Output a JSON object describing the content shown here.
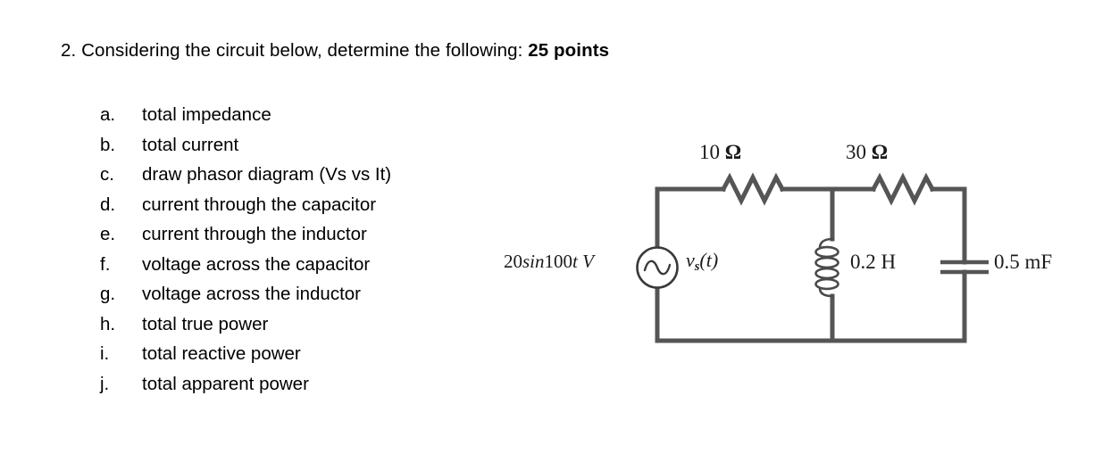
{
  "question": {
    "number": "2.",
    "text": "Considering the circuit below, determine the following:",
    "points": "25 points",
    "full_text": "2. Considering the circuit below, determine the following: 25 points"
  },
  "subquestions": [
    {
      "marker": "a.",
      "label": "total impedance"
    },
    {
      "marker": "b.",
      "label": "total current"
    },
    {
      "marker": "c.",
      "label": "draw phasor diagram (Vs vs It)"
    },
    {
      "marker": "d.",
      "label": "current through the capacitor"
    },
    {
      "marker": "e.",
      "label": "current through the inductor"
    },
    {
      "marker": "f.",
      "label": "voltage across the capacitor"
    },
    {
      "marker": "g.",
      "label": "voltage across the inductor"
    },
    {
      "marker": "h.",
      "label": "total true power"
    },
    {
      "marker": "i.",
      "label": "total reactive power"
    },
    {
      "marker": "j.",
      "label": "total apparent power"
    }
  ],
  "circuit": {
    "source": {
      "value_prefix": "20",
      "value_sin": "sin",
      "value_freq": "100",
      "value_time": "t",
      "value_unit": "V",
      "value_full": "20sin100t V",
      "name_main": "v",
      "name_sub": "s",
      "name_arg": "(t)",
      "name_full": "vs(t)",
      "symbol": "ac-voltage-source"
    },
    "components": [
      {
        "id": "R1",
        "type": "resistor",
        "value": "10",
        "unit": "Ω",
        "label": "10 Ω",
        "position": "top-left-series"
      },
      {
        "id": "R2",
        "type": "resistor",
        "value": "30",
        "unit": "Ω",
        "label": "30 Ω",
        "position": "top-right-series"
      },
      {
        "id": "L1",
        "type": "inductor",
        "value": "0.2",
        "unit": "H",
        "label": "0.2 H",
        "position": "middle-shunt"
      },
      {
        "id": "C1",
        "type": "capacitor",
        "value": "0.5",
        "unit": "mF",
        "label": "0.5 mF",
        "position": "right-shunt"
      }
    ],
    "wire_color": "#555555",
    "label_color": "#1a1a1a"
  }
}
